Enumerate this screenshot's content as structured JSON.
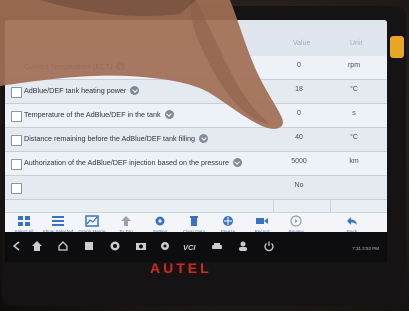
{
  "table": {
    "columns": {
      "value": "Value",
      "unit": "Unit"
    },
    "rows": [
      {
        "name": "Coolant Temperature (ECT)",
        "value": "0",
        "unit": "rpm"
      },
      {
        "name": "AdBlue/DEF tank heating power",
        "value": "18",
        "unit": "°C"
      },
      {
        "name": "Temperature of the AdBlue/DEF in the tank",
        "value": "0",
        "unit": "s"
      },
      {
        "name": "Distance remaining before the AdBlue/DEF tank filling",
        "value": "40",
        "unit": "°C"
      },
      {
        "name": "Authorization of the AdBlue/DEF injection based on the pressure",
        "value": "5000",
        "unit": "km"
      },
      {
        "name": "",
        "value": "No",
        "unit": ""
      }
    ]
  },
  "toolbar": {
    "items": [
      {
        "label": "Select All",
        "icon": "grid-icon"
      },
      {
        "label": "Show Selected",
        "icon": "list-icon"
      },
      {
        "label": "Graph Merge",
        "icon": "graph-icon"
      },
      {
        "label": "To Top",
        "icon": "arrow-up-icon"
      },
      {
        "label": "Setting",
        "icon": "gear-icon"
      },
      {
        "label": "Clear Data",
        "icon": "trash-icon"
      },
      {
        "label": "Freeze",
        "icon": "freeze-icon"
      },
      {
        "label": "Record",
        "icon": "video-icon"
      },
      {
        "label": "Review",
        "icon": "play-icon"
      },
      {
        "label": "Back",
        "icon": "back-arrow-icon"
      }
    ]
  },
  "system_bar": {
    "vci_label": "VCI",
    "status": "7:31 2:52 PM"
  },
  "device": {
    "brand": "AUTEL"
  },
  "colors": {
    "screen_bg": "#e9eef3",
    "toolbar_icon": "#3b73c4",
    "brand_red": "#d3281f",
    "side_tab": "#e8a623"
  }
}
